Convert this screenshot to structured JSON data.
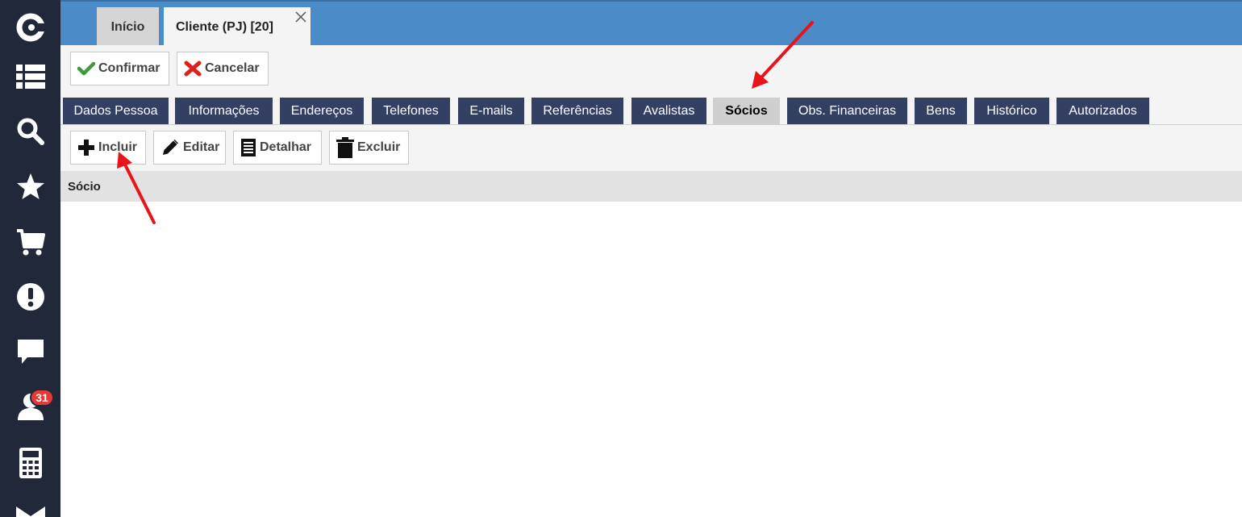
{
  "sidebar": {
    "items": [
      {
        "icon": "logo-icon"
      },
      {
        "icon": "list-icon"
      },
      {
        "icon": "search-icon"
      },
      {
        "icon": "star-icon"
      },
      {
        "icon": "cart-icon"
      },
      {
        "icon": "alert-icon"
      },
      {
        "icon": "chat-icon"
      },
      {
        "icon": "user-icon",
        "badge": "31"
      },
      {
        "icon": "calculator-icon"
      },
      {
        "icon": "mail-icon"
      }
    ]
  },
  "top_tabs": [
    {
      "label": "Início",
      "active": false
    },
    {
      "label": "Cliente (PJ) [20]",
      "active": true
    }
  ],
  "actions": {
    "confirm_label": "Confirmar",
    "cancel_label": "Cancelar"
  },
  "section_tabs": [
    {
      "label": "Dados Pessoa"
    },
    {
      "label": "Informações"
    },
    {
      "label": "Endereços"
    },
    {
      "label": "Telefones"
    },
    {
      "label": "E-mails"
    },
    {
      "label": "Referências"
    },
    {
      "label": "Avalistas"
    },
    {
      "label": "Sócios",
      "active": true
    },
    {
      "label": "Obs. Financeiras"
    },
    {
      "label": "Bens"
    },
    {
      "label": "Histórico"
    },
    {
      "label": "Autorizados"
    }
  ],
  "row_actions": {
    "include_label": "Incluir",
    "edit_label": "Editar",
    "detail_label": "Detalhar",
    "delete_label": "Excluir"
  },
  "table": {
    "columns": [
      "Sócio"
    ],
    "rows": []
  },
  "colors": {
    "sidebar": "#212839",
    "topbar": "#4a8bc8",
    "section_tab": "#344063",
    "section_tab_active": "#cfcfcf",
    "confirm_green": "#3a9c3a",
    "cancel_red": "#e02020",
    "annotation_arrow": "#e8141b"
  }
}
